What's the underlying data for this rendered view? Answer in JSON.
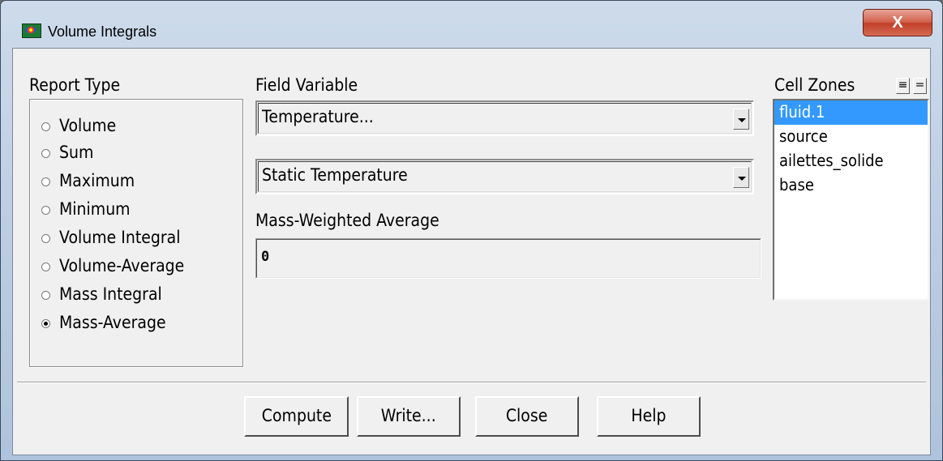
{
  "window": {
    "title": "Volume Integrals",
    "close_label": "X"
  },
  "report_type": {
    "heading": "Report Type",
    "options": [
      {
        "label": "Volume",
        "checked": false
      },
      {
        "label": "Sum",
        "checked": false
      },
      {
        "label": "Maximum",
        "checked": false
      },
      {
        "label": "Minimum",
        "checked": false
      },
      {
        "label": "Volume Integral",
        "checked": false
      },
      {
        "label": "Volume-Average",
        "checked": false
      },
      {
        "label": "Mass Integral",
        "checked": false
      },
      {
        "label": "Mass-Average",
        "checked": true
      }
    ]
  },
  "field_variable": {
    "heading": "Field Variable",
    "category": "Temperature...",
    "variable": "Static Temperature"
  },
  "result": {
    "heading": "Mass-Weighted Average",
    "value": "0"
  },
  "cell_zones": {
    "heading": "Cell Zones",
    "select_all_label": "≡",
    "deselect_all_label": "=",
    "items": [
      {
        "label": "fluid.1",
        "selected": true
      },
      {
        "label": "source",
        "selected": false
      },
      {
        "label": "ailettes_solide",
        "selected": false
      },
      {
        "label": "base",
        "selected": false
      }
    ]
  },
  "buttons": {
    "compute": "Compute",
    "write": "Write...",
    "close": "Close",
    "help": "Help"
  }
}
